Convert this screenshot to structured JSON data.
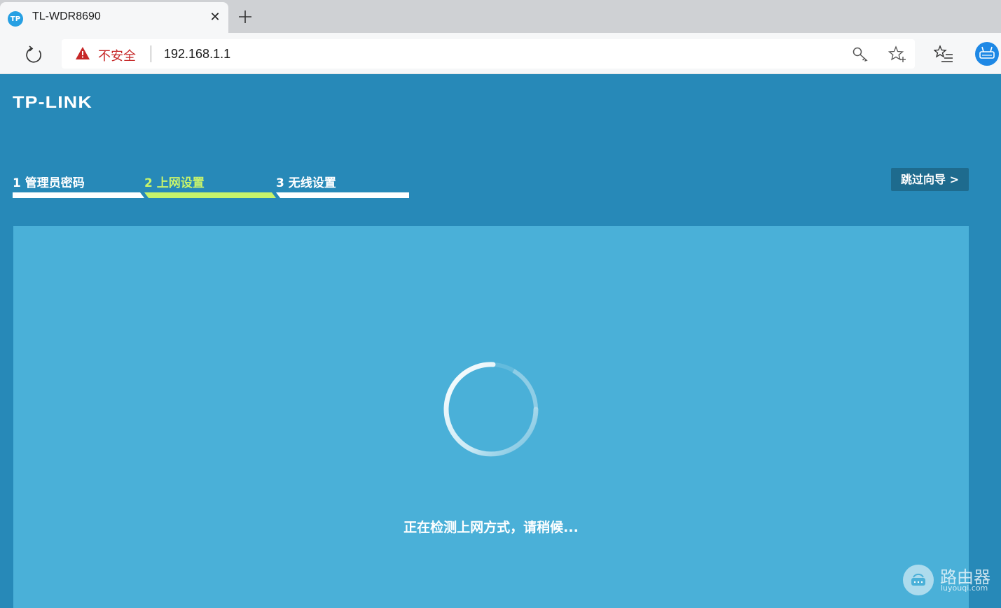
{
  "browser": {
    "tab": {
      "favicon_text": "TP",
      "title": "TL-WDR8690"
    },
    "security_label": "不安全",
    "url": "192.168.1.1"
  },
  "page": {
    "logo": "TP-LINK",
    "steps": [
      {
        "label": "1 管理员密码",
        "active": false
      },
      {
        "label": "2 上网设置",
        "active": true
      },
      {
        "label": "3 无线设置",
        "active": false
      }
    ],
    "skip_label": "跳过向导 >",
    "status": "正在检测上网方式，请稍候..."
  },
  "watermark": {
    "name": "路由器",
    "domain": "luyouqi.com"
  },
  "colors": {
    "page_bg": "#2789b8",
    "panel_bg": "#4ab0d8",
    "active_step": "#c7f36b",
    "skip_button": "#1e6b8e"
  }
}
